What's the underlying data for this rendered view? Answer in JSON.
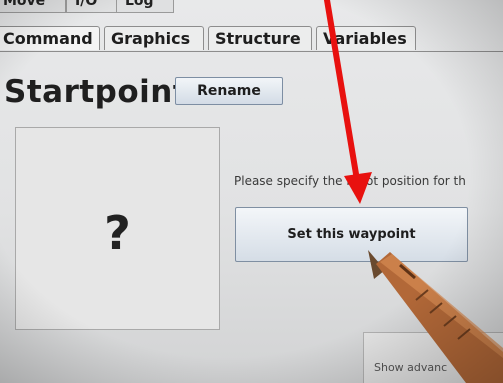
{
  "top_tabs": [
    "Move",
    "I/O",
    "Log"
  ],
  "sub_tabs": [
    "Command",
    "Graphics",
    "Structure",
    "Variables"
  ],
  "active_sub_tab": "Command",
  "node_title": "Startpoint",
  "rename_label": "Rename",
  "image_placeholder": "?",
  "prompt_text": "Please specify the robot position for th",
  "set_waypoint_label": "Set this waypoint",
  "advanced_label": "Show advanc",
  "colors": {
    "arrow": "#e8110f",
    "pen": "#b5693a",
    "background": "#e4e5e6"
  }
}
